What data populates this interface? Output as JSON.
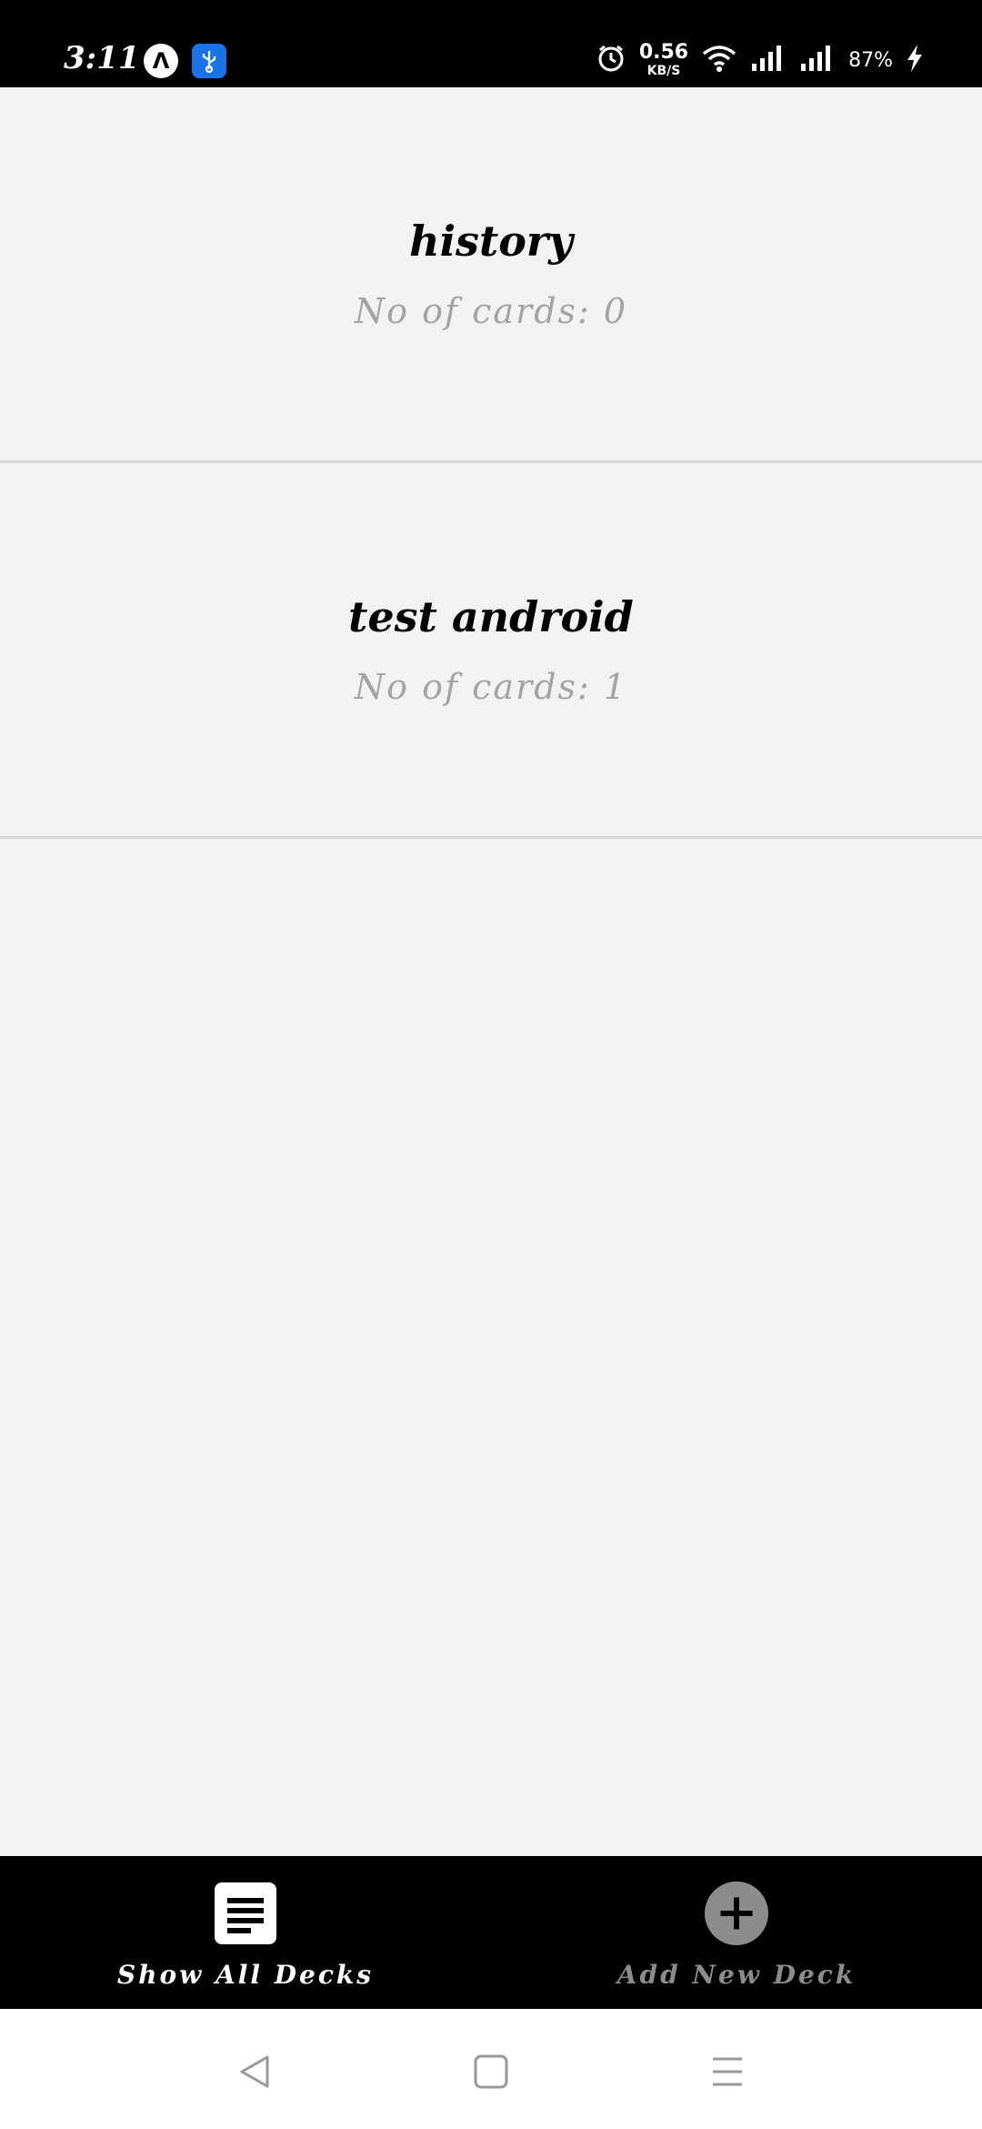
{
  "status_bar": {
    "time": "3:11",
    "network_speed_value": "0.56",
    "network_speed_unit": "KB/S",
    "battery": "87%"
  },
  "decks": [
    {
      "title": "history",
      "count_text": "No of cards: 0"
    },
    {
      "title": "test android",
      "count_text": "No of cards: 1"
    }
  ],
  "tabs": [
    {
      "label": "Show All Decks",
      "icon": "list-icon",
      "active": true
    },
    {
      "label": "Add New Deck",
      "icon": "add-circle-icon",
      "active": false
    }
  ],
  "colors": {
    "background": "#f2f2f2",
    "bars": "#000000",
    "subtle_text": "#a3a3a3",
    "inactive_tab": "#8c8c8c",
    "usb_badge": "#1a73e8"
  }
}
